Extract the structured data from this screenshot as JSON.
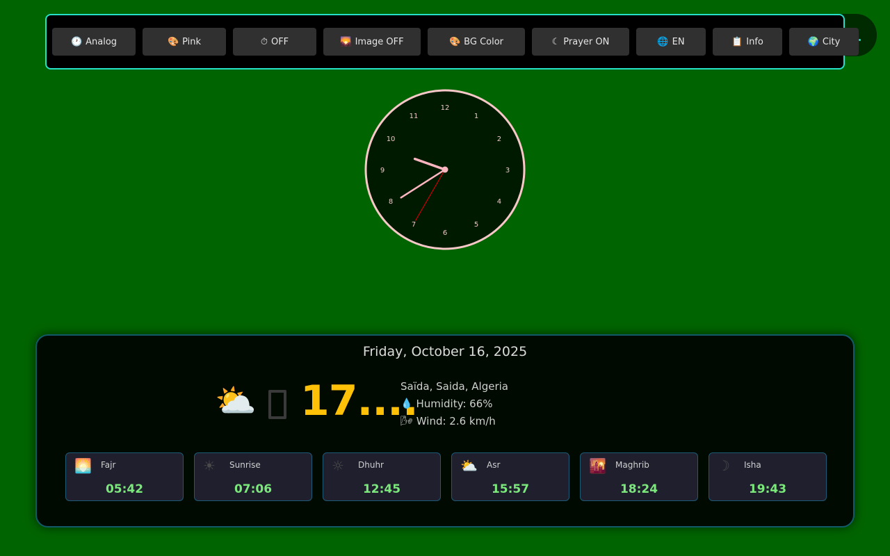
{
  "toolbar": {
    "buttons": [
      {
        "icon": "🕐",
        "label": "Analog"
      },
      {
        "icon": "🎨",
        "label": "Pink"
      },
      {
        "icon": "⏱",
        "label": "OFF"
      },
      {
        "icon": "🌄",
        "label": "Image OFF"
      },
      {
        "icon": "🎨",
        "label": "BG Color"
      },
      {
        "icon": "☾",
        "label": "Prayer ON"
      },
      {
        "icon": "🌐",
        "label": "EN"
      },
      {
        "icon": "📋",
        "label": "Info"
      },
      {
        "icon": "🌍",
        "label": "City"
      }
    ]
  },
  "clock": {
    "numbers": [
      "12",
      "1",
      "2",
      "3",
      "4",
      "5",
      "6",
      "7",
      "8",
      "9",
      "10",
      "11"
    ],
    "hour": 9,
    "minute": 39,
    "second": 35,
    "colors": {
      "face": "#001a00",
      "rim": "#f8c8c8",
      "hand": "#ffb6c1",
      "second_hand": "#cc0000",
      "numbers": "#f0c8c8"
    }
  },
  "date": "Friday, October 16, 2025",
  "weather": {
    "icon": "⛅",
    "temp": "17....",
    "location": "Saïda, Saida, Algeria",
    "humidity_icon": "💧",
    "humidity": "Humidity: 66%",
    "wind_icon": "🌬",
    "wind": "Wind: 2.6 km/h"
  },
  "prayers": [
    {
      "icon": "🌅",
      "name": "Fajr",
      "time": "05:42"
    },
    {
      "icon": "☀",
      "name": "Sunrise",
      "time": "07:06"
    },
    {
      "icon": "☼",
      "name": "Dhuhr",
      "time": "12:45"
    },
    {
      "icon": "⛅",
      "name": "Asr",
      "time": "15:57"
    },
    {
      "icon": "🌇",
      "name": "Maghrib",
      "time": "18:24"
    },
    {
      "icon": "☽",
      "name": "Isha",
      "time": "19:43"
    }
  ],
  "colors": {
    "background": "#006400",
    "accent": "#27e0c8",
    "temp": "#ffc107",
    "prayer_time": "#7ce87c"
  }
}
